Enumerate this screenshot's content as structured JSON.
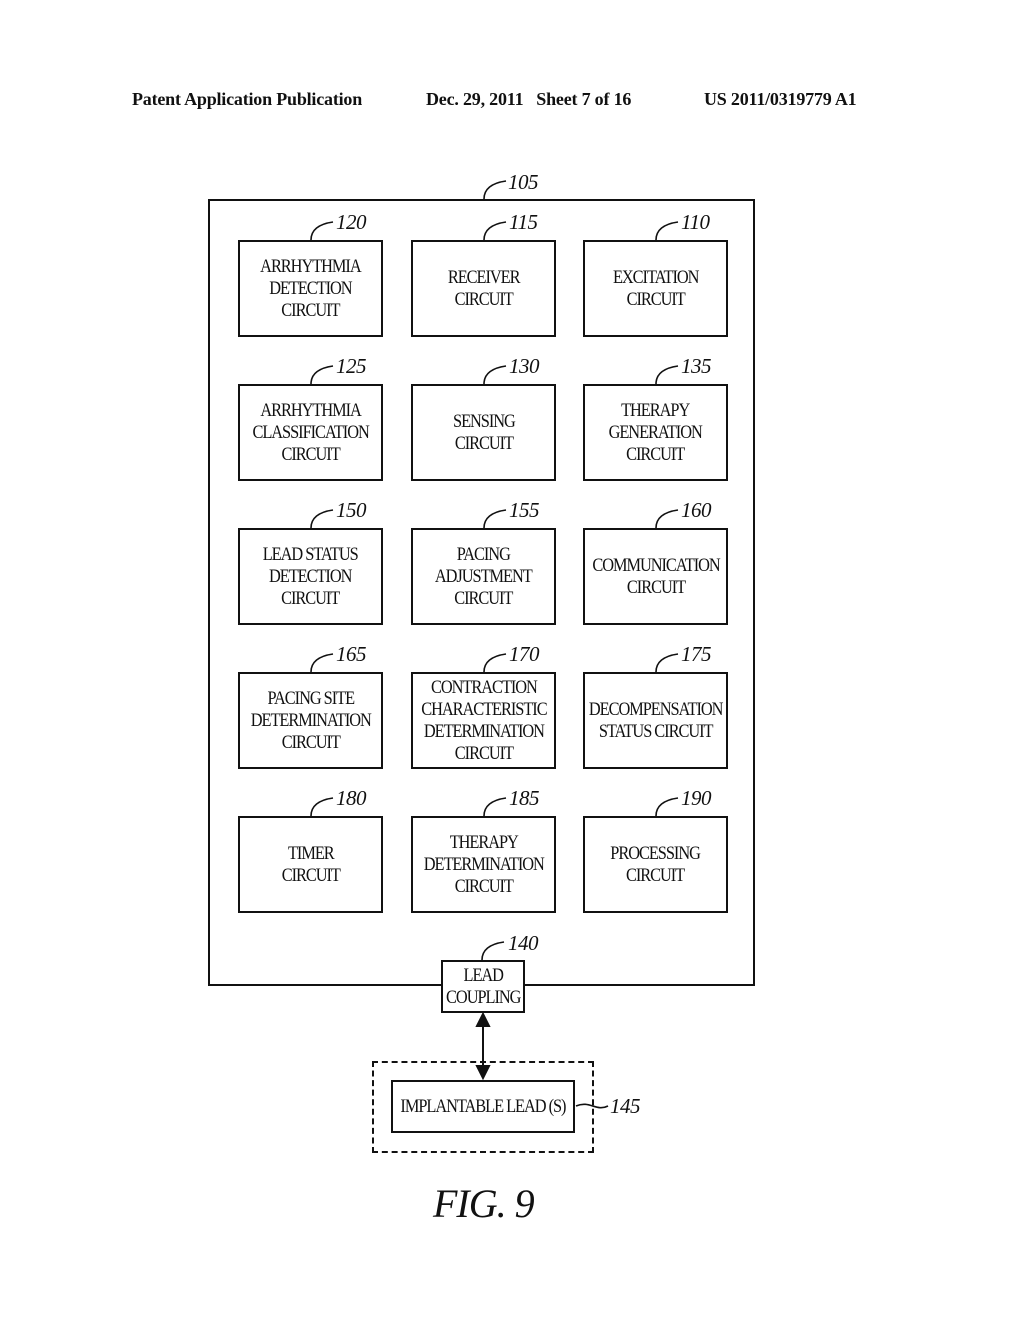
{
  "header": {
    "left": "Patent Application Publication",
    "middle": "Dec. 29, 2011   Sheet 7 of 16",
    "right": "US 2011/0319779 A1"
  },
  "device": {
    "ref": "105",
    "blocks": [
      {
        "ref": "120",
        "label": "ARRHYTHMIA\nDETECTION\nCIRCUIT"
      },
      {
        "ref": "115",
        "label": "RECEIVER\nCIRCUIT"
      },
      {
        "ref": "110",
        "label": "EXCITATION\nCIRCUIT"
      },
      {
        "ref": "125",
        "label": "ARRHYTHMIA\nCLASSIFICATION\nCIRCUIT"
      },
      {
        "ref": "130",
        "label": "SENSING\nCIRCUIT"
      },
      {
        "ref": "135",
        "label": "THERAPY\nGENERATION\nCIRCUIT"
      },
      {
        "ref": "150",
        "label": "LEAD STATUS\nDETECTION\nCIRCUIT"
      },
      {
        "ref": "155",
        "label": "PACING\nADJUSTMENT\nCIRCUIT"
      },
      {
        "ref": "160",
        "label": "COMMUNICATION\nCIRCUIT"
      },
      {
        "ref": "165",
        "label": "PACING SITE\nDETERMINATION\nCIRCUIT"
      },
      {
        "ref": "170",
        "label": "CONTRACTION\nCHARACTERISTIC\nDETERMINATION\nCIRCUIT"
      },
      {
        "ref": "175",
        "label": "DECOMPENSATION\nSTATUS CIRCUIT"
      },
      {
        "ref": "180",
        "label": "TIMER\nCIRCUIT"
      },
      {
        "ref": "185",
        "label": "THERAPY\nDETERMINATION\nCIRCUIT"
      },
      {
        "ref": "190",
        "label": "PROCESSING\nCIRCUIT"
      }
    ]
  },
  "lead_coupling": {
    "ref": "140",
    "label": "LEAD\nCOUPLING"
  },
  "implantable_lead": {
    "ref": "145",
    "label": "IMPLANTABLE LEAD (S)"
  },
  "figure_label": "FIG. 9"
}
